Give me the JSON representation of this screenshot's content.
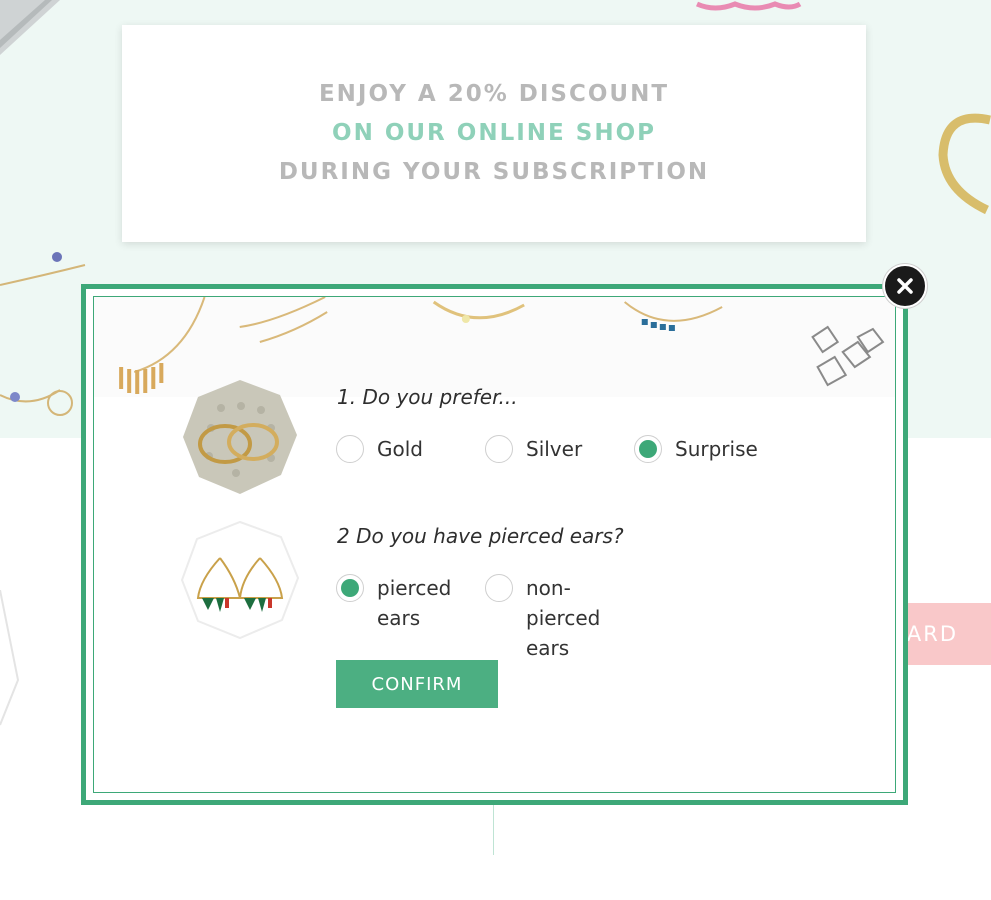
{
  "colors": {
    "accent": "#3da878",
    "promo_text": "#b8b8b8",
    "promo_accent": "#8fd1b9",
    "pink_button": "#f9c8c9"
  },
  "promo": {
    "line1": "ENJOY A 20% DISCOUNT",
    "line2": "ON OUR ONLINE SHOP",
    "line3": "DURING YOUR SUBSCRIPTION"
  },
  "background_button": {
    "label": "ARD"
  },
  "modal": {
    "close_icon": "close-icon",
    "question1": {
      "text": "1. Do you prefer...",
      "options": [
        {
          "label": "Gold",
          "selected": false
        },
        {
          "label": "Silver",
          "selected": false
        },
        {
          "label": "Surprise",
          "selected": true
        }
      ]
    },
    "question2": {
      "text": "2 Do you have pierced ears?",
      "options": [
        {
          "label_lines": [
            "pierced",
            "ears"
          ],
          "selected": true
        },
        {
          "label_lines": [
            "non-",
            "pierced",
            "ears"
          ],
          "selected": false
        }
      ]
    },
    "confirm_label": "CONFIRM"
  }
}
